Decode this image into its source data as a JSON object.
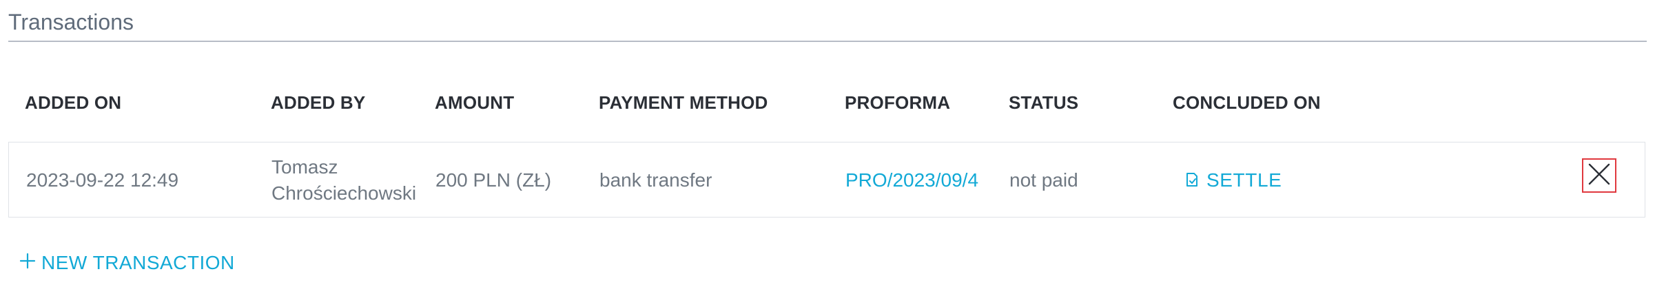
{
  "section": {
    "title": "Transactions"
  },
  "table": {
    "columns": [
      "ADDED ON",
      "ADDED BY",
      "AMOUNT",
      "PAYMENT METHOD",
      "PROFORMA",
      "STATUS",
      "CONCLUDED ON"
    ],
    "rows": [
      {
        "added_on": "2023-09-22 12:49",
        "added_by": "Tomasz Chrościechowski",
        "amount": "200 PLN (ZŁ)",
        "payment_method": "bank transfer",
        "proforma": "PRO/2023/09/4",
        "status": "not paid",
        "settle_label": "SETTLE"
      }
    ]
  },
  "actions": {
    "new_transaction_label": "NEW TRANSACTION"
  },
  "icons": {
    "settle": "settle-receipt-icon",
    "close": "close-icon",
    "add": "plus-icon"
  },
  "colors": {
    "link": "#12a9d6",
    "heading": "#2b2f36",
    "text": "#6f7882",
    "close_highlight": "#e0383e"
  }
}
